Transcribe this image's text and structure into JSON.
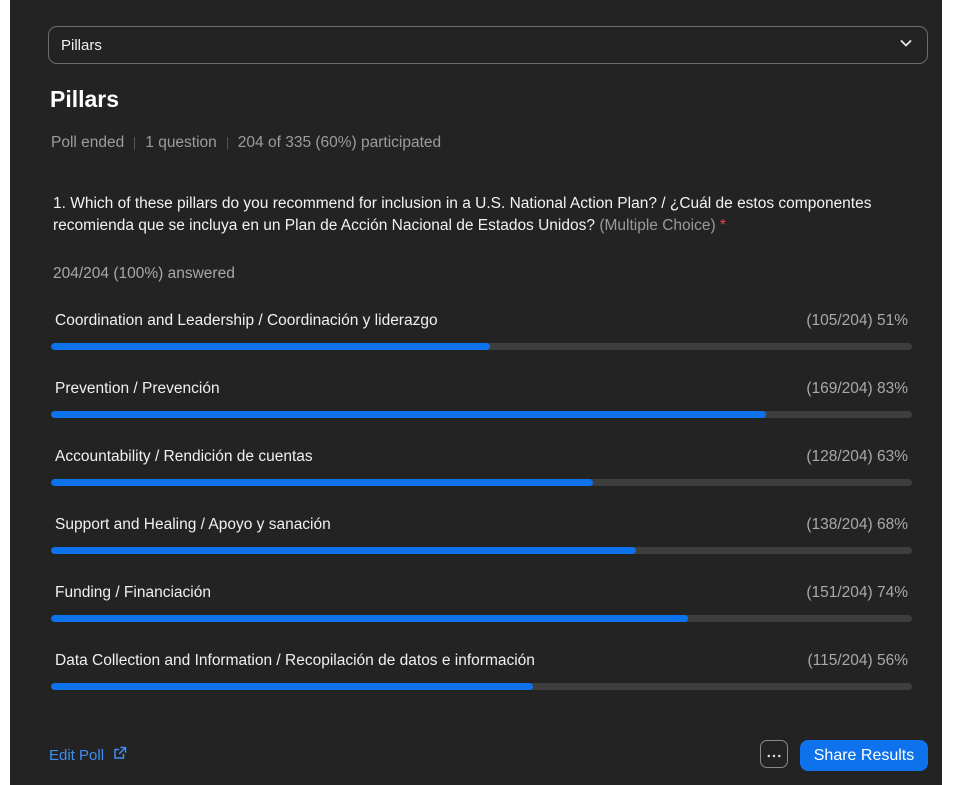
{
  "dropdown": {
    "selected": "Pillars"
  },
  "poll": {
    "title": "Pillars",
    "status": "Poll ended",
    "question_count": "1 question",
    "participation": "204 of 335 (60%) participated"
  },
  "question": {
    "text": "1. Which of these pillars do you recommend for inclusion in a U.S. National Action Plan? / ¿Cuál de estos componentes recomienda que se incluya en un Plan de Acción Nacional de Estados Unidos?",
    "type": "(Multiple Choice)",
    "required_mark": "*",
    "answered": "204/204 (100%) answered"
  },
  "options": [
    {
      "label": "Coordination and Leadership / Coordinación y liderazgo",
      "count": "(105/204) 51%",
      "fraction": 0.51
    },
    {
      "label": "Prevention / Prevención",
      "count": "(169/204) 83%",
      "fraction": 0.83
    },
    {
      "label": "Accountability / Rendición de cuentas",
      "count": "(128/204) 63%",
      "fraction": 0.63
    },
    {
      "label": "Support and Healing / Apoyo y sanación",
      "count": "(138/204) 68%",
      "fraction": 0.68
    },
    {
      "label": "Funding / Financiación",
      "count": "(151/204) 74%",
      "fraction": 0.74
    },
    {
      "label": "Data Collection and Information / Recopilación de datos e información",
      "count": "(115/204) 56%",
      "fraction": 0.56
    }
  ],
  "footer": {
    "edit_label": "Edit Poll",
    "more_label": "···",
    "share_label": "Share Results"
  },
  "colors": {
    "accent": "#0e72ed",
    "panel_bg": "#232323",
    "track": "#3e3e3e",
    "required": "#e5484d",
    "link": "#3f8ef4"
  },
  "icons": {
    "dropdown": "chevron-down-icon",
    "edit": "external-link-icon",
    "more": "more-icon"
  }
}
